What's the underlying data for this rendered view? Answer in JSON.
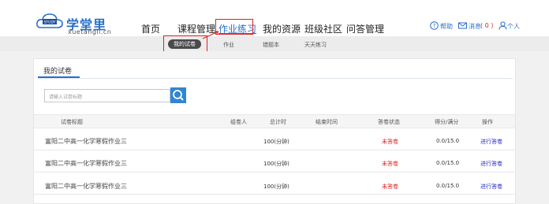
{
  "header": {
    "logo_text": "学堂里",
    "logo_sub": "xuetangli.cn",
    "logo_badge": "STUDY",
    "nav": [
      "首页",
      "课程管理",
      "作业练习",
      "我的资源",
      "班级社区",
      "问答管理"
    ],
    "active_nav_index": 2,
    "help": "帮助",
    "messages": "消息",
    "message_count": "( 0 )",
    "personal": "个人"
  },
  "subnav": {
    "items": [
      "我的试卷",
      "作业",
      "错题本",
      "天天练习"
    ],
    "active_index": 0
  },
  "card": {
    "title": "我的试卷",
    "search_placeholder": "请输入试卷标题"
  },
  "table": {
    "columns": [
      "试卷标题",
      "组卷人",
      "总计时",
      "结束时间",
      "答卷状态",
      "得分/满分",
      "操作"
    ],
    "rows": [
      {
        "title": "富阳二中高一化学寒假作业三",
        "author": "",
        "time": "100(分钟)",
        "end": "",
        "status": "未答卷",
        "score": "0.0/15.0",
        "action": "进行答卷"
      },
      {
        "title": "富阳二中高一化学寒假作业三",
        "author": "",
        "time": "100(分钟)",
        "end": "",
        "status": "未答卷",
        "score": "0.0/15.0",
        "action": "进行答卷"
      },
      {
        "title": "富阳二中高一化学寒假作业三",
        "author": "",
        "time": "100(分钟)",
        "end": "",
        "status": "未答卷",
        "score": "0.0/15.0",
        "action": "进行答卷"
      }
    ]
  },
  "colors": {
    "brand": "#2a6fc9",
    "highlight_box": "#e02020",
    "search_button": "#2e86d4",
    "status_unanswered": "#e02020",
    "action_link": "#2a2ac9"
  }
}
